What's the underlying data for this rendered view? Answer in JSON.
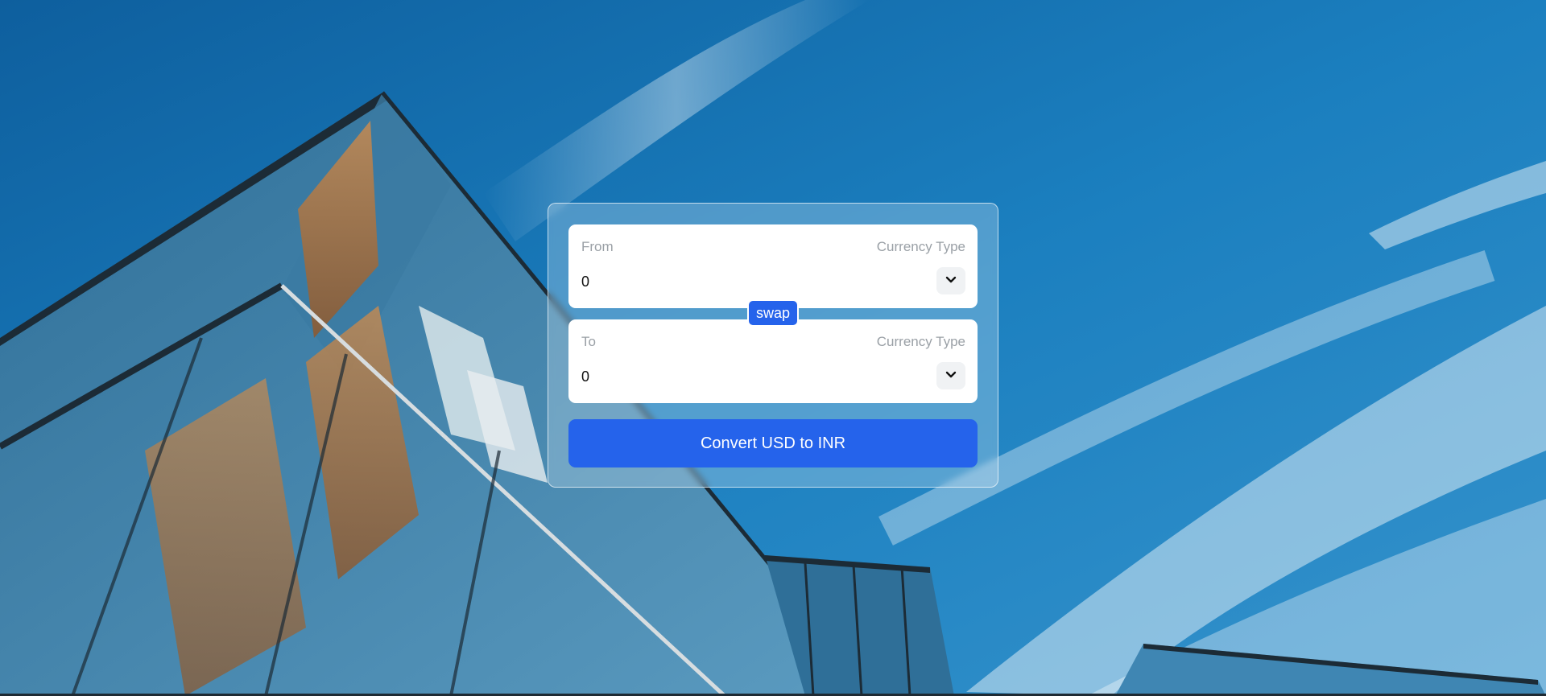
{
  "converter": {
    "from": {
      "label": "From",
      "type_label": "Currency Type",
      "amount": "0",
      "select_icon": "chevron-down-icon"
    },
    "swap_label": "swap",
    "to": {
      "label": "To",
      "type_label": "Currency Type",
      "amount": "0",
      "select_icon": "chevron-down-icon"
    },
    "convert_label": "Convert USD to INR"
  },
  "colors": {
    "accent": "#2563eb",
    "sky": "#1679b8",
    "field_bg": "#ffffff",
    "muted_text": "#9aa0a6"
  }
}
